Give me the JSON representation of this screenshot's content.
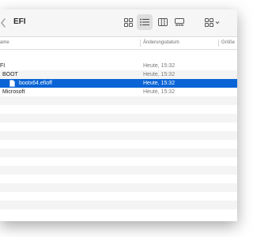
{
  "toolbar": {
    "title": "EFI",
    "buttons": [
      {
        "name": "icon-view-button",
        "icon": "grid-icon",
        "active": false
      },
      {
        "name": "list-view-button",
        "icon": "list-icon",
        "active": true
      },
      {
        "name": "column-view-button",
        "icon": "columns-icon",
        "active": false
      },
      {
        "name": "gallery-view-button",
        "icon": "gallery-icon",
        "active": false
      },
      {
        "name": "group-button",
        "icon": "group-grid-icon",
        "active": false
      }
    ]
  },
  "columns": {
    "name": "ame",
    "date": "Änderungsdatum",
    "size": "Größe"
  },
  "rows": [
    {
      "name": "FI",
      "date": "Heute, 15:32",
      "selected": false
    },
    {
      "name": "BOOT",
      "date": "Heute, 15:32",
      "selected": false
    },
    {
      "name": "bootx64.efioff",
      "date": "Heute, 15:32",
      "selected": true,
      "icon": "document-icon"
    },
    {
      "name": "Microsoft",
      "date": "Heute, 15:32",
      "selected": false
    }
  ],
  "colors": {
    "selection": "#0a64d6",
    "stripe": "#f4f4f4",
    "toolbar": "#f6f6f6"
  }
}
